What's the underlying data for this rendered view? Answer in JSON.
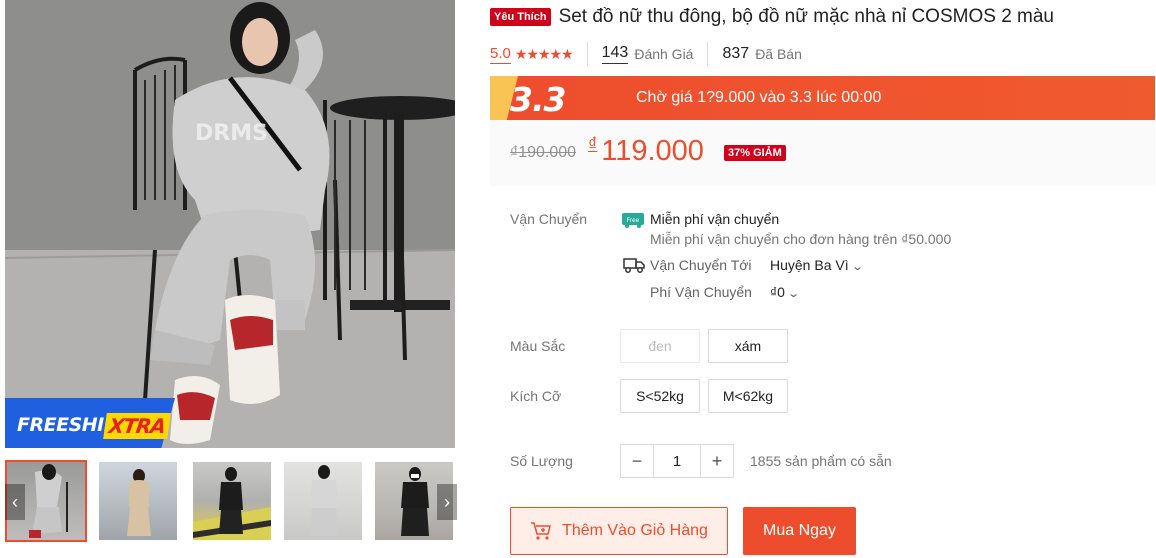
{
  "colors": {
    "brand": "#ee4d2d",
    "badge_red": "#d0011b",
    "freeship_blue": "#1f5fe0",
    "xtra_yellow": "#ffd800"
  },
  "gallery": {
    "main_image_alt": "",
    "freeship": {
      "text": "FREESHIP",
      "xtra": "XTRA"
    },
    "thumbnails": [
      {
        "icon": "thumbnail-image"
      },
      {
        "icon": "thumbnail-image"
      },
      {
        "icon": "thumbnail-image"
      },
      {
        "icon": "thumbnail-image"
      },
      {
        "icon": "thumbnail-image"
      }
    ],
    "prev_icon": "‹",
    "next_icon": "›"
  },
  "product": {
    "badge": "Yêu Thích",
    "title": "Set đồ nữ thu đông, bộ đồ nữ mặc nhà nỉ COSMOS 2 màu",
    "rating": "5.0",
    "stars": "★★★★★",
    "reviews_count": "143",
    "reviews_label": "Đánh Giá",
    "sold_count": "837",
    "sold_label": "Đã Bán"
  },
  "flash_sale": {
    "logo": "3.3",
    "text": "Chờ giá 1?9.000 vào 3.3 lúc 00:00"
  },
  "price": {
    "old": "₫190.000",
    "currency": "₫",
    "current": "119.000",
    "discount": "37% GIẢM"
  },
  "shipping": {
    "label": "Vận Chuyển",
    "free_title": "Miễn phí vận chuyển",
    "free_sub": "Miễn phí vận chuyển cho đơn hàng trên ₫50.000",
    "free_icon_text": "Free",
    "to_label": "Vận Chuyển Tới",
    "to_value": "Huyện Ba Vì",
    "fee_label": "Phí Vận Chuyển",
    "fee_value": "₫0"
  },
  "options": {
    "color_label": "Màu Sắc",
    "colors": [
      {
        "label": "đen",
        "disabled": true
      },
      {
        "label": "xám",
        "disabled": false
      }
    ],
    "size_label": "Kích Cỡ",
    "sizes": [
      {
        "label": "S<52kg"
      },
      {
        "label": "M<62kg"
      }
    ]
  },
  "quantity": {
    "label": "Số Lượng",
    "minus": "−",
    "value": "1",
    "plus": "+",
    "stock": "1855 sản phẩm có sẵn"
  },
  "actions": {
    "add_to_cart": "Thêm Vào Giỏ Hàng",
    "buy_now": "Mua Ngay"
  }
}
